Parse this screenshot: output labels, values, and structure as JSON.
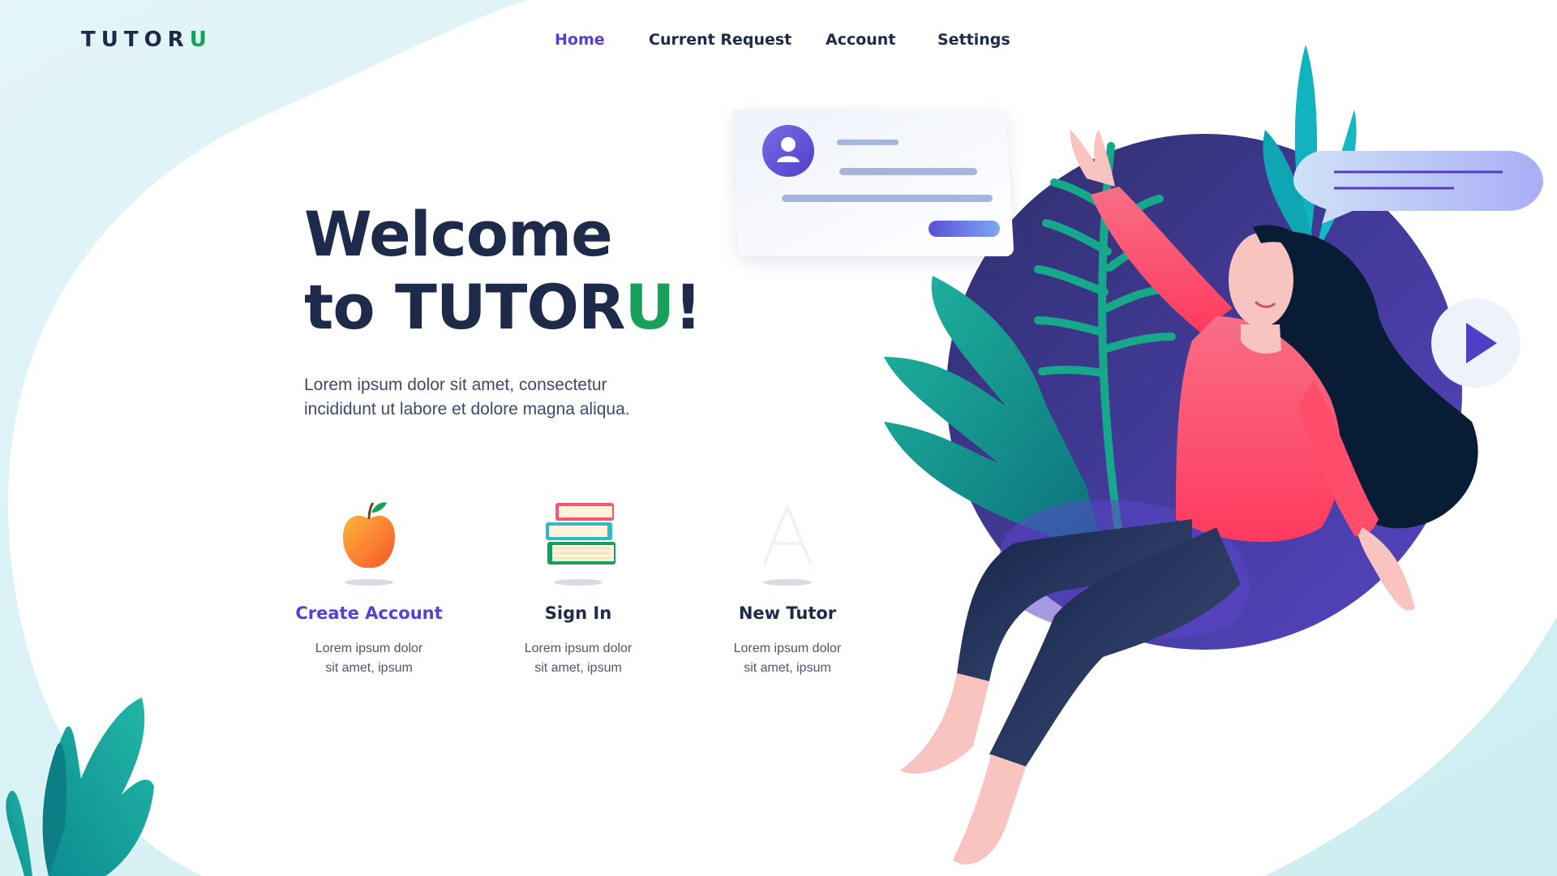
{
  "brand": {
    "name_prefix": "TUTOR",
    "name_suffix": "U"
  },
  "nav": {
    "items": [
      {
        "label": "Home",
        "active": true
      },
      {
        "label": "Current Request",
        "active": false
      },
      {
        "label": "Account",
        "active": false
      },
      {
        "label": "Settings",
        "active": false
      }
    ]
  },
  "hero": {
    "line1": "Welcome",
    "line2_prefix": "to TUTOR",
    "line2_accent": "U",
    "line2_suffix": "!",
    "description_line1": "Lorem ipsum dolor sit amet, consectetur",
    "description_line2": "incididunt ut labore et dolore magna aliqua."
  },
  "features": [
    {
      "title": "Create Account",
      "desc_line1": "Lorem ipsum dolor",
      "desc_line2": "sit amet, ipsum",
      "icon": "apple-icon"
    },
    {
      "title": "Sign In",
      "desc_line1": "Lorem ipsum dolor",
      "desc_line2": "sit amet, ipsum",
      "icon": "books-icon"
    },
    {
      "title": "New Tutor",
      "desc_line1": "Lorem ipsum dolor",
      "desc_line2": "sit amet, ipsum",
      "icon": "graduation-cap-icon"
    }
  ],
  "colors": {
    "brand_green": "#16a05c",
    "accent_purple": "#5a3fcf",
    "navy": "#1d2a4a",
    "sweater_pink": "#f65676",
    "circle_purple": "#3f3a95",
    "teal": "#0f9b9b"
  }
}
